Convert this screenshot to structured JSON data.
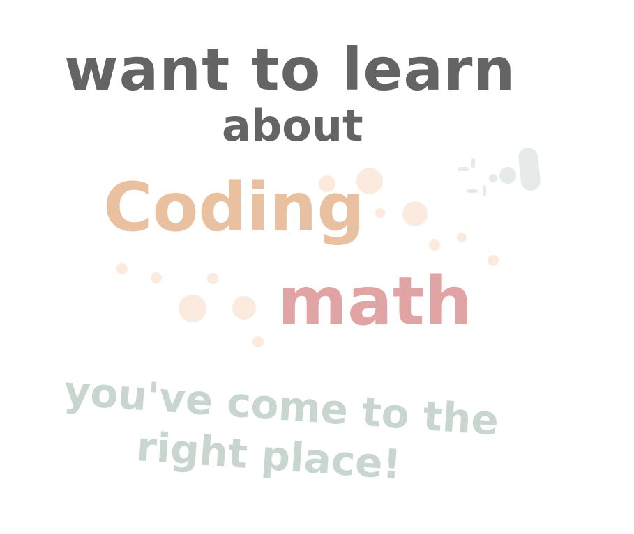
{
  "headline": {
    "line1": "want to learn",
    "line2": "about"
  },
  "topics": [
    "Coding",
    "math"
  ],
  "tagline": {
    "line1": "you've come to the",
    "line2": "right place!"
  },
  "colors": {
    "headline": "#646464",
    "topic_coding": "#e9c0a0",
    "topic_math": "#e0a4a4",
    "tagline": "#c9d6d0",
    "decor_peach": "#fbeadd",
    "decor_gray": "#e6ebea"
  }
}
